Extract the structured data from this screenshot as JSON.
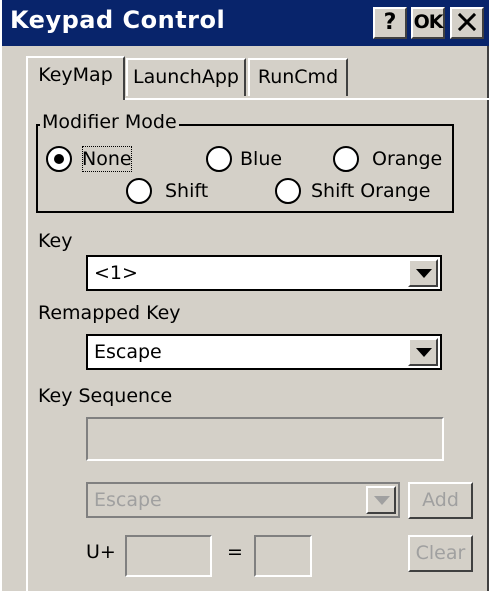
{
  "window": {
    "title": "Keypad Control",
    "help_label": "?",
    "ok_label": "OK",
    "close_label": "×"
  },
  "tabs": [
    {
      "label": "KeyMap",
      "active": true
    },
    {
      "label": "LaunchApp",
      "active": false
    },
    {
      "label": "RunCmd",
      "active": false
    }
  ],
  "modifier_mode": {
    "legend": "Modifier Mode",
    "selected": "None",
    "options": [
      {
        "label": "None"
      },
      {
        "label": "Blue"
      },
      {
        "label": "Orange"
      },
      {
        "label": "Shift"
      },
      {
        "label": "Shift Orange"
      }
    ]
  },
  "key": {
    "label": "Key",
    "value": "<1>"
  },
  "remapped_key": {
    "label": "Remapped Key",
    "value": "Escape"
  },
  "key_sequence": {
    "label": "Key Sequence",
    "value": "",
    "select_value": "Escape",
    "add_label": "Add",
    "clear_label": "Clear",
    "unicode_prefix": "U+",
    "equals": "=",
    "unicode_value": "",
    "char_value": ""
  },
  "colors": {
    "titlebar": "#08246b",
    "face": "#d4d0c8",
    "disabled_text": "#a0a0a0"
  },
  "icons": [
    "help-icon",
    "close-icon",
    "chevron-down-icon"
  ]
}
